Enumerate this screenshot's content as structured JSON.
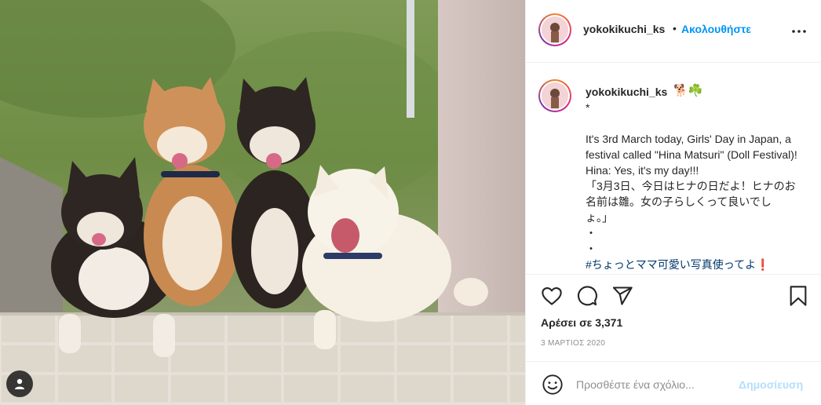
{
  "post": {
    "username": "yokokikuchi_ks",
    "follow_label": "Ακολουθήστε",
    "header_separator": "•",
    "more_icon": "more-horizontal-icon"
  },
  "caption": {
    "username": "yokokikuchi_ks",
    "emoji": "🐕☘️",
    "text": "*\n\nIt's 3rd March today, Girls' Day in Japan, a festival called \"Hina Matsuri\" (Doll Festival)! Hina: Yes, it's my day!!!\n「3月3日、今日はヒナの日だよ！ヒナのお名前は雛。女の子らしくって良いでしょ。」\n・\n・",
    "hashtag": "#ちょっとママ可愛い写真使ってよ❗️"
  },
  "actions": {
    "icons": [
      "heart-icon",
      "comment-icon",
      "share-icon",
      "bookmark-icon"
    ],
    "likes_text": "Αρέσει σε 3,371",
    "date_text": "3 ΜΑΡΤΙΟΣ 2020"
  },
  "comment": {
    "placeholder": "Προσθέστε ένα σχόλιο...",
    "post_label": "Δημοσίευση",
    "emoji_icon": "smile-icon"
  },
  "photo": {
    "alt": "Four Shiba Inu dogs sitting on a tiled stone wall",
    "user_tag_icon": "user-tag-icon"
  },
  "colors": {
    "link_blue": "#0095f6",
    "hashtag_blue": "#00376b",
    "disabled_blue": "#b2dffc",
    "muted_gray": "#8e8e8e",
    "text": "#262626",
    "divider": "#efefef"
  }
}
